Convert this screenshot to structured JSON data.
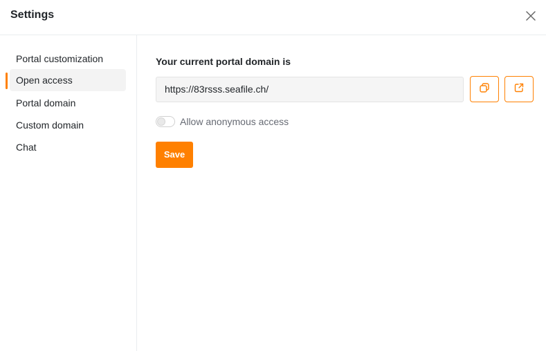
{
  "dialog": {
    "title": "Settings",
    "close_icon": "close-icon"
  },
  "sidebar": {
    "items": [
      {
        "label": "Portal customization",
        "active": false
      },
      {
        "label": "Open access",
        "active": true
      },
      {
        "label": "Portal domain",
        "active": false
      },
      {
        "label": "Custom domain",
        "active": false
      },
      {
        "label": "Chat",
        "active": false
      }
    ]
  },
  "main": {
    "section_label": "Your current portal domain is",
    "domain_url": "https://83rsss.seafile.ch/",
    "copy_icon": "copy-icon",
    "open_link_icon": "external-link-icon",
    "toggle_label": "Allow anonymous access",
    "toggle_on": false,
    "save_label": "Save"
  },
  "colors": {
    "accent": "#ff8000",
    "border": "#e9ecef",
    "active_bg": "#f3f3f3"
  }
}
